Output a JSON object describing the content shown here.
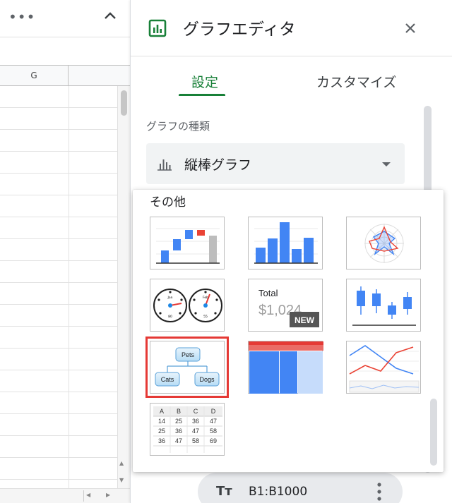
{
  "sheet": {
    "more_label": "•••",
    "column_label": "G"
  },
  "editor": {
    "title": "グラフエディタ",
    "tabs": [
      {
        "label": "設定",
        "active": true
      },
      {
        "label": "カスタマイズ",
        "active": false
      }
    ],
    "chart_type_section_label": "グラフの種類",
    "chart_type_selected": "縦棒グラフ",
    "data_range": "B1:B1000",
    "accent_color": "#188038"
  },
  "dropdown": {
    "group_label": "その他",
    "scorecard": {
      "title": "Total",
      "value": "$1,024",
      "badge": "NEW"
    },
    "org_chart": {
      "root": "Pets",
      "children": [
        "Cats",
        "Dogs"
      ]
    },
    "table_chart": {
      "headers": [
        "A",
        "B",
        "C",
        "D"
      ],
      "rows": [
        [
          "14",
          "25",
          "36",
          "47"
        ],
        [
          "25",
          "36",
          "47",
          "58"
        ],
        [
          "36",
          "47",
          "58",
          "69"
        ]
      ]
    },
    "gauge": {
      "labels": [
        "Jan",
        "Feb",
        "80",
        "55"
      ]
    },
    "items": [
      {
        "name": "waterfall-chart"
      },
      {
        "name": "histogram-chart"
      },
      {
        "name": "radar-chart"
      },
      {
        "name": "gauge-chart"
      },
      {
        "name": "scorecard-chart"
      },
      {
        "name": "candlestick-chart"
      },
      {
        "name": "org-chart",
        "selected": true
      },
      {
        "name": "treemap-chart"
      },
      {
        "name": "timeline-chart"
      },
      {
        "name": "table-chart"
      }
    ],
    "selection_color": "#e53935"
  },
  "icons": {
    "more": "more-horiz-icon",
    "collapse": "chevron-up-icon",
    "chart": "chart-icon",
    "close": "close-icon",
    "bar": "bar-chart-icon",
    "caret": "caret-down-icon",
    "text_format": "text-format-icon",
    "menu": "more-vert-icon"
  }
}
